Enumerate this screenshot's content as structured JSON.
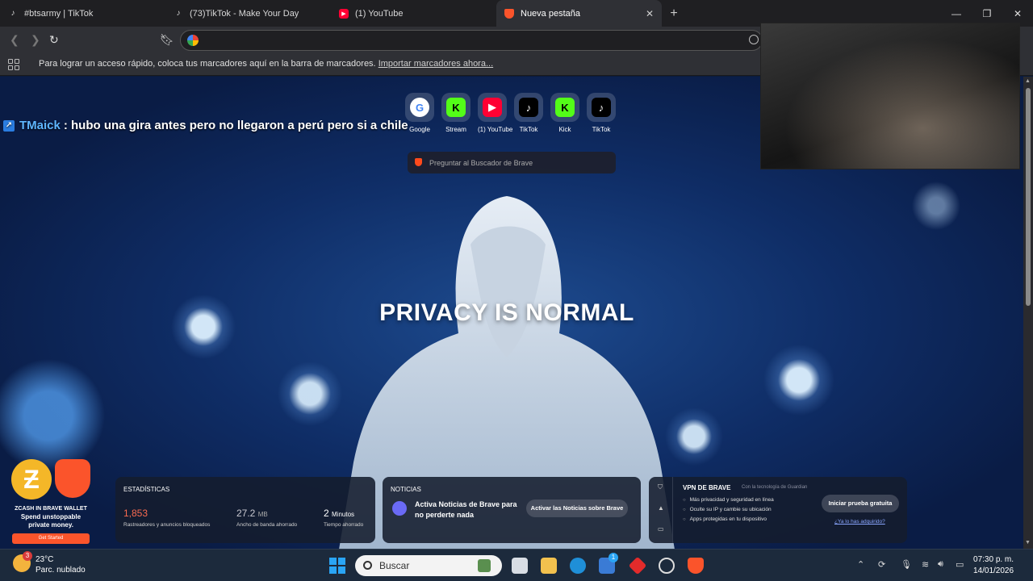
{
  "tabs": [
    {
      "title": "#btsarmy | TikTok",
      "icon": "tiktok-icon"
    },
    {
      "title": "(73)TikTok - Make Your Day",
      "icon": "tiktok-icon"
    },
    {
      "title": "(1) YouTube",
      "icon": "youtube-icon"
    },
    {
      "title": "Nueva pestaña",
      "icon": "brave-icon",
      "active": true
    }
  ],
  "omnibox": {
    "value": "",
    "placeholder": ""
  },
  "bookmarks_bar": {
    "message": "Para lograr un acceso rápido, coloca tus marcadores aquí en la barra de marcadores.",
    "import_link": "Importar marcadores ahora..."
  },
  "chat_overlay": {
    "user": "TMaick",
    "message": ": hubo una gira antes pero no llegaron a perú pero si a chile"
  },
  "top_sites": [
    {
      "label": "Google",
      "icon": "google-icon",
      "glyph": "G",
      "bg": "#ffffff",
      "fg": "#4285f4"
    },
    {
      "label": "Stream",
      "icon": "kick-icon",
      "glyph": "K",
      "bg": "#53fc18",
      "fg": "#000000"
    },
    {
      "label": "(1) YouTube",
      "icon": "youtube-icon",
      "glyph": "▶",
      "bg": "#ff0033",
      "fg": "#ffffff"
    },
    {
      "label": "TikTok",
      "icon": "tiktok-icon",
      "glyph": "♪",
      "bg": "#000000",
      "fg": "#ffffff"
    },
    {
      "label": "Kick",
      "icon": "kick-icon",
      "glyph": "K",
      "bg": "#53fc18",
      "fg": "#000000"
    },
    {
      "label": "TikTok",
      "icon": "tiktok-icon",
      "glyph": "♪",
      "bg": "#000000",
      "fg": "#ffffff"
    }
  ],
  "brave_search": {
    "placeholder": "Preguntar al Buscador de Brave"
  },
  "slogan": "PRIVACY IS NORMAL",
  "wallet": {
    "title": "ZCASH IN BRAVE WALLET",
    "text": "Spend unstoppable private money.",
    "button": "Get Started"
  },
  "stats": {
    "heading": "ESTADÍSTICAS",
    "items": [
      {
        "value": "1,853",
        "unit": "",
        "label": "Rastreadores y anuncios bloqueados",
        "color": "#fb6b50"
      },
      {
        "value": "27.2",
        "unit": "MB",
        "label": "Ancho de banda ahorrado",
        "color": "#c8c8d0"
      },
      {
        "value": "2",
        "unit": "Minutos",
        "label": "Tiempo ahorrado",
        "color": "#ffffff"
      }
    ]
  },
  "news": {
    "heading": "NOTICIAS",
    "text": "Activa Noticias de Brave para no perderte nada",
    "button": "Activar las Noticias sobre Brave"
  },
  "vpn": {
    "title": "VPN DE BRAVE",
    "powered": "Con la tecnología de Guardian",
    "features": [
      "Más privacidad y seguridad en línea",
      "Oculte su IP y cambie su ubicación",
      "Apps protegidas en tu dispositivo"
    ],
    "button": "Iniciar prueba gratuita",
    "link": "¿Ya lo has adquirido?"
  },
  "taskbar": {
    "weather_temp": "23°C",
    "weather_desc": "Parc. nublado",
    "weather_badge": "3",
    "search_placeholder": "Buscar",
    "store_badge": "1",
    "time": "07:30 p. m.",
    "date": "14/01/2026"
  },
  "colors": {
    "brave_orange": "#fb542b",
    "accent_blue": "#5eb6ff"
  }
}
